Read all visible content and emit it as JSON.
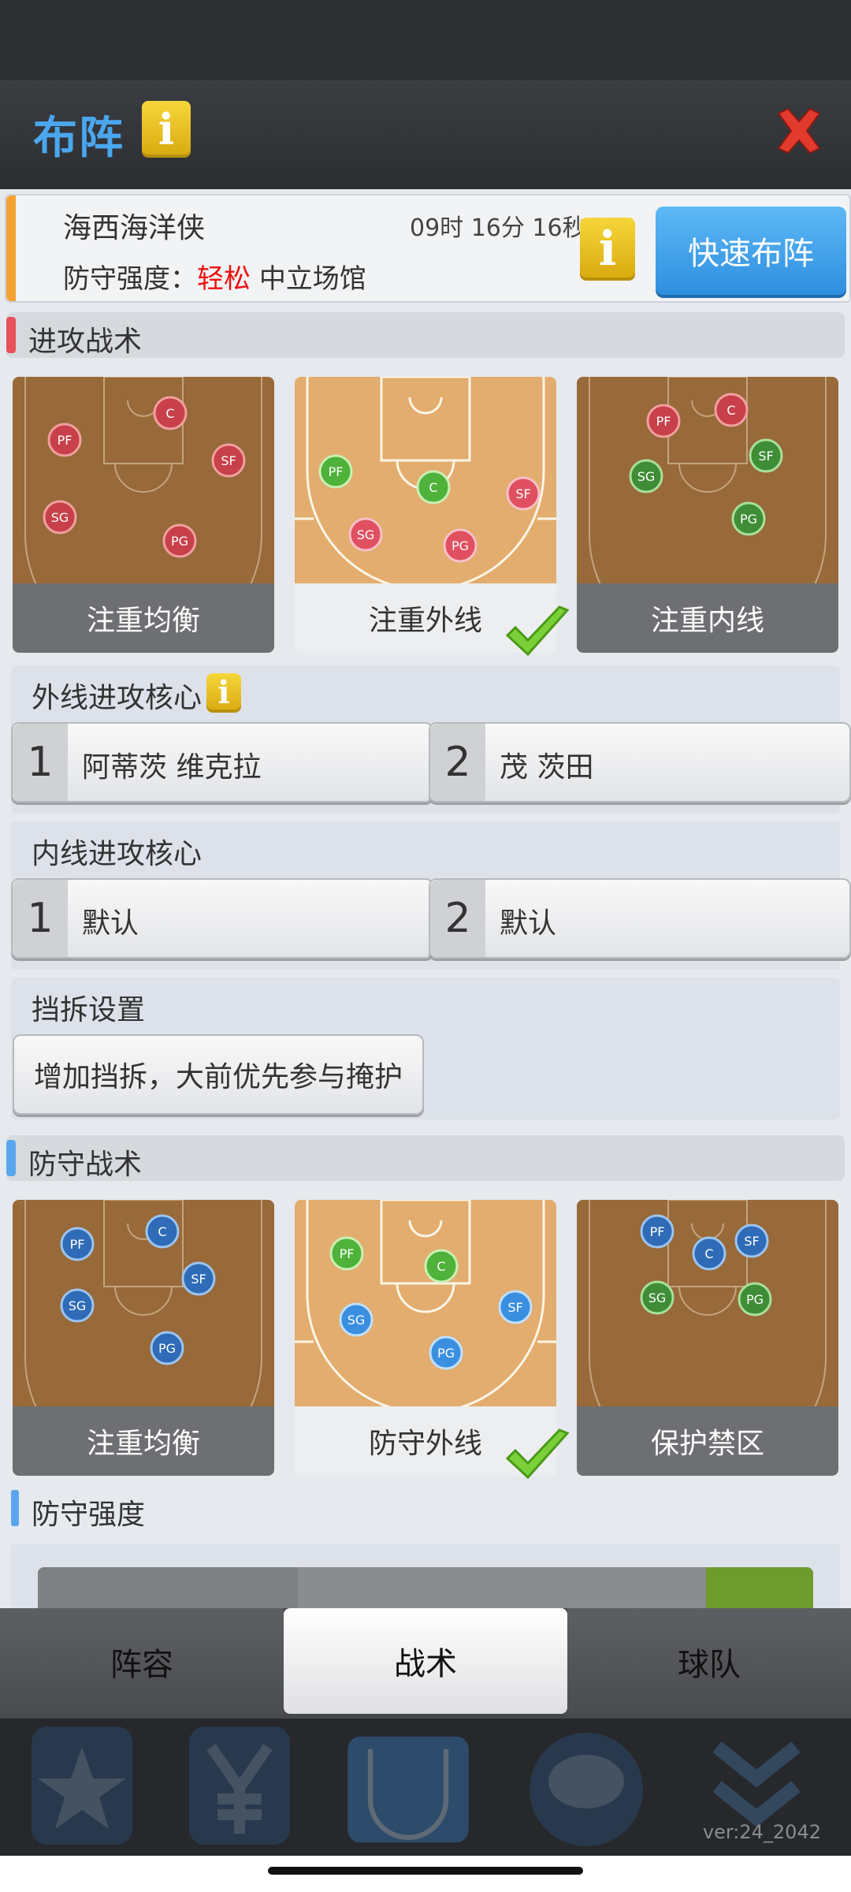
{
  "header": {
    "title": "布阵",
    "info_icon": "i",
    "close_icon": "close-x"
  },
  "summary": {
    "team_name": "海西海洋侠",
    "timer": "09时 16分 16秒",
    "defense_label": "防守强度：",
    "defense_value": "轻松",
    "venue": "中立场馆",
    "info_icon": "i",
    "quick_button": "快速布阵"
  },
  "offense": {
    "title": "进攻战术",
    "cards": [
      {
        "label": "注重均衡",
        "selected": false
      },
      {
        "label": "注重外线",
        "selected": true
      },
      {
        "label": "注重内线",
        "selected": false
      }
    ],
    "perimeter_core": {
      "label": "外线进攻核心",
      "info_icon": "i",
      "slots": [
        {
          "num": "1",
          "value": "阿蒂茨 维克拉"
        },
        {
          "num": "2",
          "value": "茂 茨田"
        }
      ]
    },
    "inside_core": {
      "label": "内线进攻核心",
      "slots": [
        {
          "num": "1",
          "value": "默认"
        },
        {
          "num": "2",
          "value": "默认"
        }
      ]
    },
    "screen": {
      "label": "挡拆设置",
      "value": "增加挡拆，大前优先参与掩护"
    }
  },
  "defense": {
    "title": "防守战术",
    "cards": [
      {
        "label": "注重均衡",
        "selected": false
      },
      {
        "label": "防守外线",
        "selected": true
      },
      {
        "label": "保护禁区",
        "selected": false
      }
    ],
    "intensity_label": "防守强度"
  },
  "tabs": [
    {
      "label": "阵容"
    },
    {
      "label": "战术",
      "active": true
    },
    {
      "label": "球队"
    }
  ],
  "version": "ver:24_2042",
  "colors": {
    "accent_blue": "#4aa7ee",
    "offense_bar": "#e8525c",
    "defense_bar": "#5aa6ee",
    "orange_stripe": "#f3a233"
  }
}
